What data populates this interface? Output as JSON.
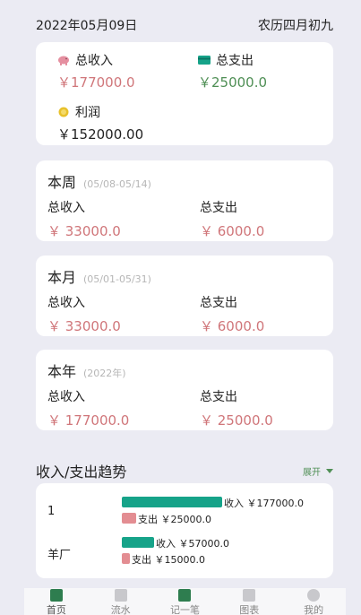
{
  "header": {
    "date": "2022年05月09日",
    "lunar": "农历四月初九"
  },
  "summary": {
    "income_label": "总收入",
    "income_value": "￥177000.0",
    "expense_label": "总支出",
    "expense_value": "￥25000.0",
    "profit_label": "利润",
    "profit_value": "￥152000.00"
  },
  "periods": [
    {
      "title": "本周",
      "range": "(05/08-05/14)",
      "income_label": "总收入",
      "income_value": "￥ 33000.0",
      "expense_label": "总支出",
      "expense_value": "￥ 6000.0"
    },
    {
      "title": "本月",
      "range": "(05/01-05/31)",
      "income_label": "总收入",
      "income_value": "￥ 33000.0",
      "expense_label": "总支出",
      "expense_value": "￥ 6000.0"
    },
    {
      "title": "本年",
      "range": "(2022年)",
      "income_label": "总收入",
      "income_value": "￥ 177000.0",
      "expense_label": "总支出",
      "expense_value": "￥ 25000.0"
    }
  ],
  "trend": {
    "title": "收入/支出趋势",
    "expand_label": "展开",
    "rows": [
      {
        "name": "1",
        "income_label": "收入 ￥177000.0",
        "expense_label": "支出 ￥25000.0",
        "income": 177000,
        "expense": 25000
      },
      {
        "name": "羊厂",
        "income_label": "收入 ￥57000.0",
        "expense_label": "支出 ￥15000.0",
        "income": 57000,
        "expense": 15000
      }
    ]
  },
  "tabs": [
    {
      "label": "首页",
      "icon": "home-icon"
    },
    {
      "label": "流水",
      "icon": "list-icon"
    },
    {
      "label": "记一笔",
      "icon": "add-record-icon"
    },
    {
      "label": "图表",
      "icon": "chart-icon"
    },
    {
      "label": "我的",
      "icon": "profile-icon"
    }
  ],
  "colors": {
    "income": "#d0767a",
    "expense": "#4f8f55",
    "bar_income": "#16a389",
    "bar_expense": "#e38d92",
    "accent": "#2e7d4f"
  }
}
